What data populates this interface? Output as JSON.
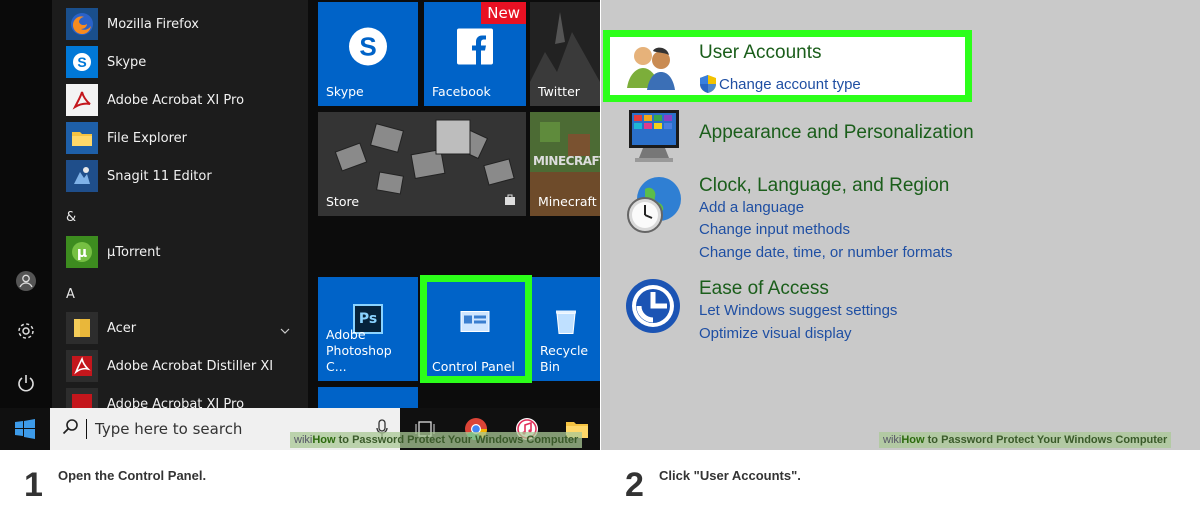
{
  "start_menu": {
    "apps": [
      {
        "label": "Mozilla Firefox",
        "icon": "firefox-icon"
      },
      {
        "label": "Skype",
        "icon": "skype-icon"
      },
      {
        "label": "Adobe Acrobat XI Pro",
        "icon": "acrobat-icon"
      },
      {
        "label": "File Explorer",
        "icon": "folder-icon"
      },
      {
        "label": "Snagit 11 Editor",
        "icon": "snagit-icon"
      }
    ],
    "section_amp": "&",
    "apps_amp": [
      {
        "label": "µTorrent",
        "icon": "utorrent-icon"
      }
    ],
    "section_a": "A",
    "apps_a": [
      {
        "label": "Acer",
        "icon": "folder-icon"
      },
      {
        "label": "Adobe Acrobat Distiller XI",
        "icon": "acrobat-icon"
      },
      {
        "label": "Adobe Acrobat XI Pro",
        "icon": "acrobat-icon"
      }
    ],
    "tiles": {
      "skype": "Skype",
      "facebook": "Facebook",
      "facebook_badge": "New",
      "twitter": "Twitter",
      "store": "Store",
      "minecraft": "Minecraft",
      "minecraft_logo": "MINECRAFT",
      "photoshop": "Adobe Photoshop C...",
      "photoshop_logo": "Ps",
      "control_panel": "Control Panel",
      "recycle_bin": "Recycle Bin"
    },
    "search_placeholder": "Type here to search"
  },
  "control_panel": {
    "user_accounts": {
      "title": "User Accounts",
      "links": [
        "Change account type"
      ]
    },
    "appearance": {
      "title": "Appearance and Personalization"
    },
    "clock": {
      "title": "Clock, Language, and Region",
      "links": [
        "Add a language",
        "Change input methods",
        "Change date, time, or number formats"
      ]
    },
    "ease": {
      "title": "Ease of Access",
      "links": [
        "Let Windows suggest settings",
        "Optimize visual display"
      ]
    }
  },
  "watermark": {
    "wiki": "wiki",
    "how": "How",
    "rest": " to Password Protect Your Windows Computer"
  },
  "steps": [
    {
      "number": "1",
      "text": "Open the Control Panel."
    },
    {
      "number": "2",
      "text": "Click \"User Accounts\"."
    }
  ],
  "colors": {
    "highlight": "#2cff1a",
    "tile_blue": "#0063c8",
    "cp_title": "#1b5e1b",
    "cp_link": "#1f4fa3"
  }
}
